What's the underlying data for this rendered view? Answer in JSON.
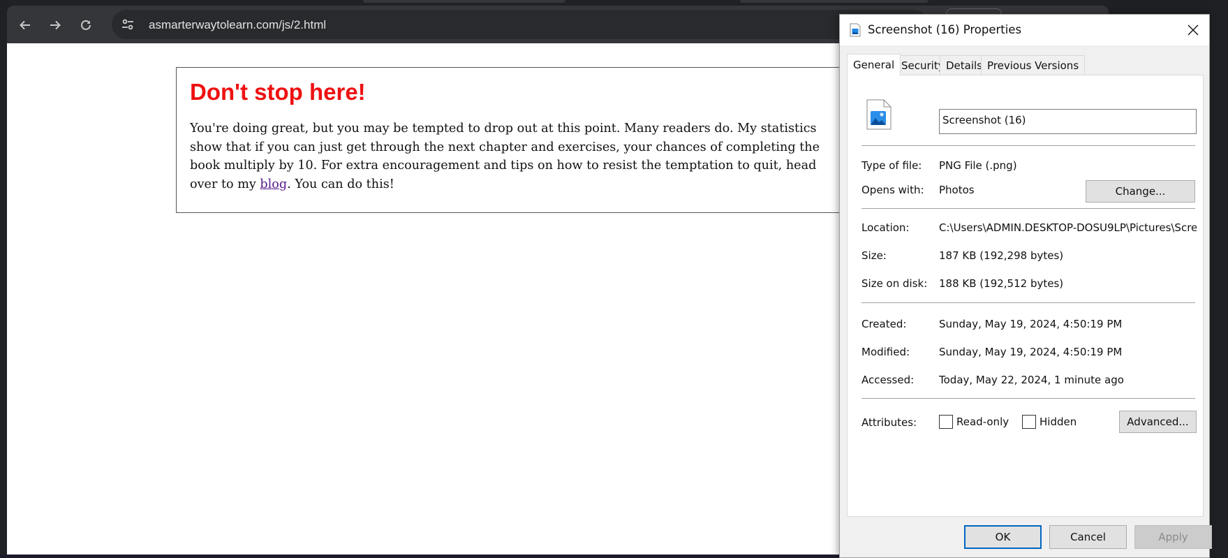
{
  "browser": {
    "url": "asmarterwaytolearn.com/js/2.html",
    "icons": {
      "back": "arrow-left-icon",
      "forward": "arrow-right-icon",
      "reload": "reload-icon",
      "site_info": "tune-icon"
    }
  },
  "page": {
    "title": "Don't stop here!",
    "text_before_link": "You're doing great, but you may be tempted to drop out at this point. Many readers do. My statistics show that if you can just get through the next chapter and exercises, your chances of completing the book multiply by 10. For extra encouragement and tips on how to resist the temptation to quit, head over to my ",
    "link_text": "blog",
    "text_after_link": ". You can do this!",
    "title_color": "#ee1111",
    "link_color": "#551a8b"
  },
  "dialog": {
    "title": "Screenshot (16) Properties",
    "tabs": [
      {
        "label": "General",
        "active": true
      },
      {
        "label": "Security",
        "active": false
      },
      {
        "label": "Details",
        "active": false
      },
      {
        "label": "Previous Versions",
        "active": false
      }
    ],
    "file_name": "Screenshot (16)",
    "type_label": "Type of file:",
    "type_value": "PNG File (.png)",
    "opens_label": "Opens with:",
    "opens_value": "Photos",
    "change_button": "Change...",
    "location_label": "Location:",
    "location_value": "C:\\Users\\ADMIN.DESKTOP-DOSU9LP\\Pictures\\Scre",
    "size_label": "Size:",
    "size_value": "187 KB (192,298 bytes)",
    "size_disk_label": "Size on disk:",
    "size_disk_value": "188 KB (192,512 bytes)",
    "created_label": "Created:",
    "created_value": "Sunday, May 19, 2024, 4:50:19 PM",
    "modified_label": "Modified:",
    "modified_value": "Sunday, May 19, 2024, 4:50:19 PM",
    "accessed_label": "Accessed:",
    "accessed_value": "Today, May 22, 2024, 1 minute ago",
    "attributes_label": "Attributes:",
    "readonly_label": "Read-only",
    "readonly_checked": false,
    "hidden_label": "Hidden",
    "hidden_checked": false,
    "advanced_button": "Advanced...",
    "ok_button": "OK",
    "cancel_button": "Cancel",
    "apply_button": "Apply",
    "apply_enabled": false,
    "accent_color": "#0067c0"
  }
}
